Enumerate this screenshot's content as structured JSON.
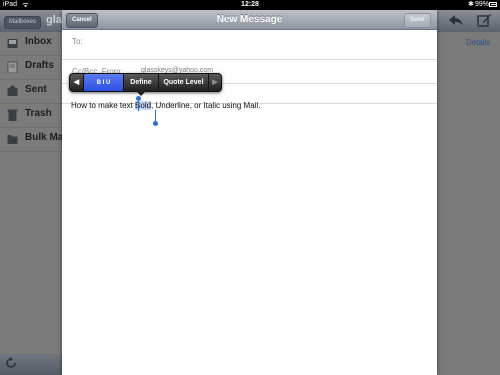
{
  "statusbar": {
    "carrier": "iPad",
    "time": "12:28",
    "battery": "99%"
  },
  "background": {
    "mailboxes_button": "Mailboxes",
    "folder_title": "glas",
    "details_link": "Details",
    "sidebar": [
      {
        "label": "Inbox",
        "icon": "inbox-icon"
      },
      {
        "label": "Drafts",
        "icon": "drafts-icon"
      },
      {
        "label": "Sent",
        "icon": "sent-icon"
      },
      {
        "label": "Trash",
        "icon": "trash-icon"
      },
      {
        "label": "Bulk Ma",
        "icon": "folder-icon"
      }
    ]
  },
  "composer": {
    "cancel_label": "Cancel",
    "title": "New Message",
    "send_label": "Send",
    "to_label": "To:",
    "cc_label": "Cc/Bcc, From:",
    "from_value": "glasskeys@yahoo.com",
    "body_before": "How to make text ",
    "body_selected": "Bold",
    "body_after": ", Underline, or Italic using Mail."
  },
  "edit_menu": {
    "biu_label": "B I U",
    "define_label": "Define",
    "quote_label": "Quote Level"
  },
  "colors": {
    "accent_selection": "#2d6fd6",
    "menu_highlight": "#3b5fe8",
    "navbar": "#a3a9b2"
  }
}
